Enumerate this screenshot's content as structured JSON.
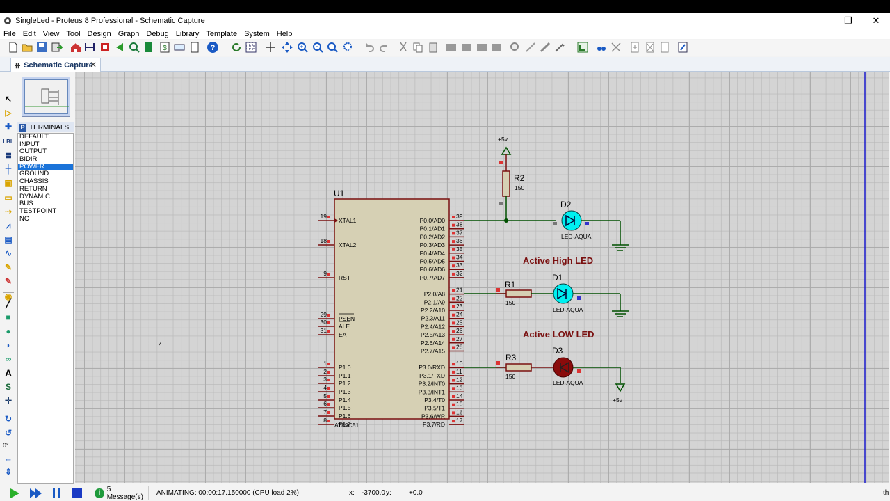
{
  "window": {
    "title": "SingleLed - Proteus 8 Professional - Schematic Capture",
    "minimize": "—",
    "restore": "❐",
    "close": "✕"
  },
  "menu": [
    "File",
    "Edit",
    "View",
    "Tool",
    "Design",
    "Graph",
    "Debug",
    "Library",
    "Template",
    "System",
    "Help"
  ],
  "tab": {
    "label": "Schematic Capture",
    "close": "✕"
  },
  "terminals": {
    "header_badge": "P",
    "header": "TERMINALS",
    "items": [
      "DEFAULT",
      "INPUT",
      "OUTPUT",
      "BIDIR",
      "POWER",
      "GROUND",
      "CHASSIS",
      "RETURN",
      "DYNAMIC",
      "BUS",
      "TESTPOINT",
      "NC"
    ],
    "selected": "POWER"
  },
  "left_tools": {
    "rotation": "0°"
  },
  "schematic": {
    "mcu": {
      "ref": "U1",
      "part": "AT89C51",
      "left_pins": [
        {
          "num": "19",
          "name": "XTAL1"
        },
        {
          "num": "18",
          "name": "XTAL2"
        },
        {
          "num": "9",
          "name": "RST"
        },
        {
          "num": "29",
          "name": "PSEN"
        },
        {
          "num": "30",
          "name": "ALE"
        },
        {
          "num": "31",
          "name": "EA"
        },
        {
          "num": "1",
          "name": "P1.0"
        },
        {
          "num": "2",
          "name": "P1.1"
        },
        {
          "num": "3",
          "name": "P1.2"
        },
        {
          "num": "4",
          "name": "P1.3"
        },
        {
          "num": "5",
          "name": "P1.4"
        },
        {
          "num": "6",
          "name": "P1.5"
        },
        {
          "num": "7",
          "name": "P1.6"
        },
        {
          "num": "8",
          "name": "P1.7"
        }
      ],
      "right_pins": [
        {
          "num": "39",
          "name": "P0.0/AD0"
        },
        {
          "num": "38",
          "name": "P0.1/AD1"
        },
        {
          "num": "37",
          "name": "P0.2/AD2"
        },
        {
          "num": "36",
          "name": "P0.3/AD3"
        },
        {
          "num": "35",
          "name": "P0.4/AD4"
        },
        {
          "num": "34",
          "name": "P0.5/AD5"
        },
        {
          "num": "33",
          "name": "P0.6/AD6"
        },
        {
          "num": "32",
          "name": "P0.7/AD7"
        },
        {
          "num": "21",
          "name": "P2.0/A8"
        },
        {
          "num": "22",
          "name": "P2.1/A9"
        },
        {
          "num": "23",
          "name": "P2.2/A10"
        },
        {
          "num": "24",
          "name": "P2.3/A11"
        },
        {
          "num": "25",
          "name": "P2.4/A12"
        },
        {
          "num": "26",
          "name": "P2.5/A13"
        },
        {
          "num": "27",
          "name": "P2.6/A14"
        },
        {
          "num": "28",
          "name": "P2.7/A15"
        },
        {
          "num": "10",
          "name": "P3.0/RXD"
        },
        {
          "num": "11",
          "name": "P3.1/TXD"
        },
        {
          "num": "12",
          "name": "P3.2/INT0"
        },
        {
          "num": "13",
          "name": "P3.3/INT1"
        },
        {
          "num": "14",
          "name": "P3.4/T0"
        },
        {
          "num": "15",
          "name": "P3.5/T1"
        },
        {
          "num": "16",
          "name": "P3.6/WR"
        },
        {
          "num": "17",
          "name": "P3.7/RD"
        }
      ]
    },
    "power_top": "+5v",
    "power_bottom": "+5v",
    "r2": {
      "ref": "R2",
      "value": "150"
    },
    "r1": {
      "ref": "R1",
      "value": "150"
    },
    "r3": {
      "ref": "R3",
      "value": "150"
    },
    "d2": {
      "ref": "D2",
      "part": "LED-AQUA"
    },
    "d1": {
      "ref": "D1",
      "part": "LED-AQUA"
    },
    "d3": {
      "ref": "D3",
      "part": "LED-AQUA"
    },
    "label_high": "Active High LED",
    "label_low": "Active LOW LED",
    "colors": {
      "wire": "#005000",
      "body": "#d6d0b4",
      "outline": "#7a1010",
      "text": "#000080",
      "led_on": "#00f0f0",
      "led_off": "#8a0b0b",
      "annotation": "#7a1010"
    }
  },
  "status": {
    "messages": "5 Message(s)",
    "info_glyph": "i",
    "animation": "ANIMATING: 00:00:17.150000 (CPU load 2%)",
    "x_label": "x:",
    "x_value": "-3700.0",
    "y_label": "y:",
    "y_value": "+0.0",
    "tail": "th"
  }
}
